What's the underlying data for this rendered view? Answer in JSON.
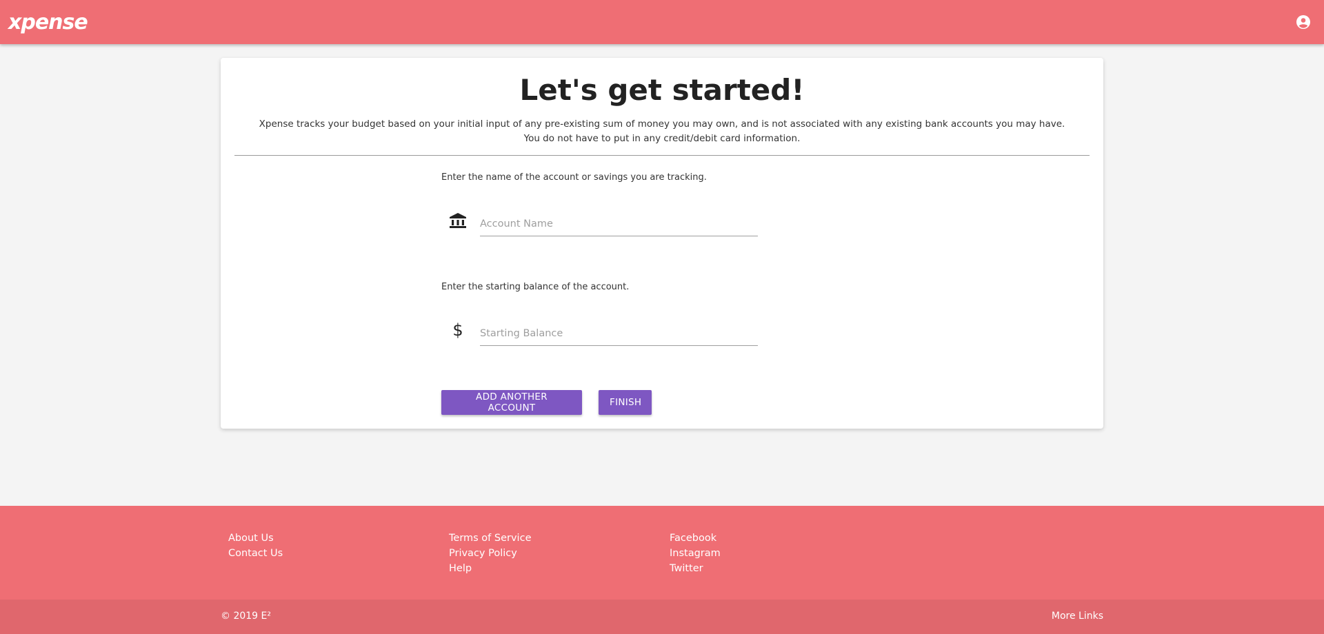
{
  "header": {
    "brand": "xpense",
    "account_icon": "account-circle-icon"
  },
  "main": {
    "title": "Let's get started!",
    "intro": "Xpense tracks your budget based on your initial input of any pre-existing sum of money you may own, and is not associated with any existing bank accounts you may have. You do not have to put in any credit/debit card information.",
    "account_name": {
      "prompt": "Enter the name of the account or savings you are tracking.",
      "icon": "bank-icon",
      "placeholder": "Account Name",
      "value": ""
    },
    "starting_balance": {
      "prompt": "Enter the starting balance of the account.",
      "icon": "dollar-icon",
      "placeholder": "Starting Balance",
      "value": ""
    },
    "buttons": {
      "add_account": "ADD ANOTHER ACCOUNT",
      "finish": "FINISH"
    }
  },
  "footer": {
    "columns": [
      [
        "About Us",
        "Contact Us"
      ],
      [
        "Terms of Service",
        "Privacy Policy",
        "Help"
      ],
      [
        "Facebook",
        "Instagram",
        "Twitter"
      ]
    ],
    "copyright": "© 2019 E²",
    "more_links": "More Links"
  },
  "colors": {
    "primary": "#ef6e74",
    "footer_bottom": "#e0676d",
    "button": "#7e57c2",
    "background": "#f4f4f4"
  }
}
